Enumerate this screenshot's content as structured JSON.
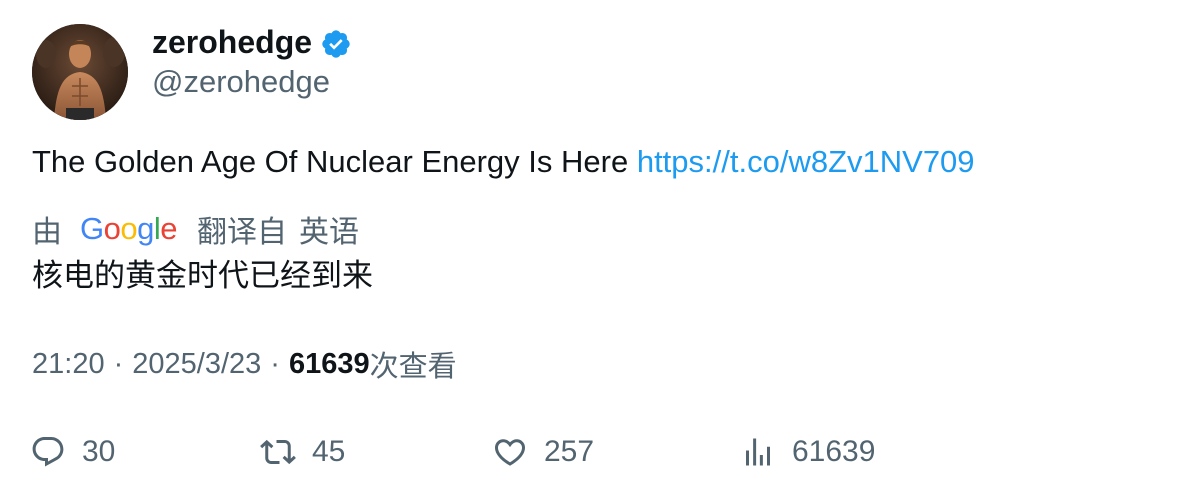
{
  "author": {
    "display_name": "zerohedge",
    "handle": "@zerohedge",
    "verified": true
  },
  "tweet": {
    "text": "The Golden Age Of Nuclear Energy Is Here",
    "link": "https://t.co/w8Zv1NV709"
  },
  "translation": {
    "by_label": "由",
    "provider": "Google",
    "translated_from_label": "翻译自",
    "source_language": "英语",
    "text": "核电的黄金时代已经到来"
  },
  "meta": {
    "time": "21:20",
    "separator": "·",
    "date": "2025/3/23",
    "views_count": "61639",
    "views_label": "次查看"
  },
  "actions": {
    "replies": "30",
    "retweets": "45",
    "likes": "257",
    "views": "61639"
  },
  "colors": {
    "text_primary": "#0f1419",
    "text_secondary": "#536471",
    "link": "#1d9bf0",
    "verified_badge": "#1d9bf0"
  },
  "icons": [
    "reply-icon",
    "retweet-icon",
    "like-icon",
    "views-icon",
    "verified-badge-icon"
  ]
}
